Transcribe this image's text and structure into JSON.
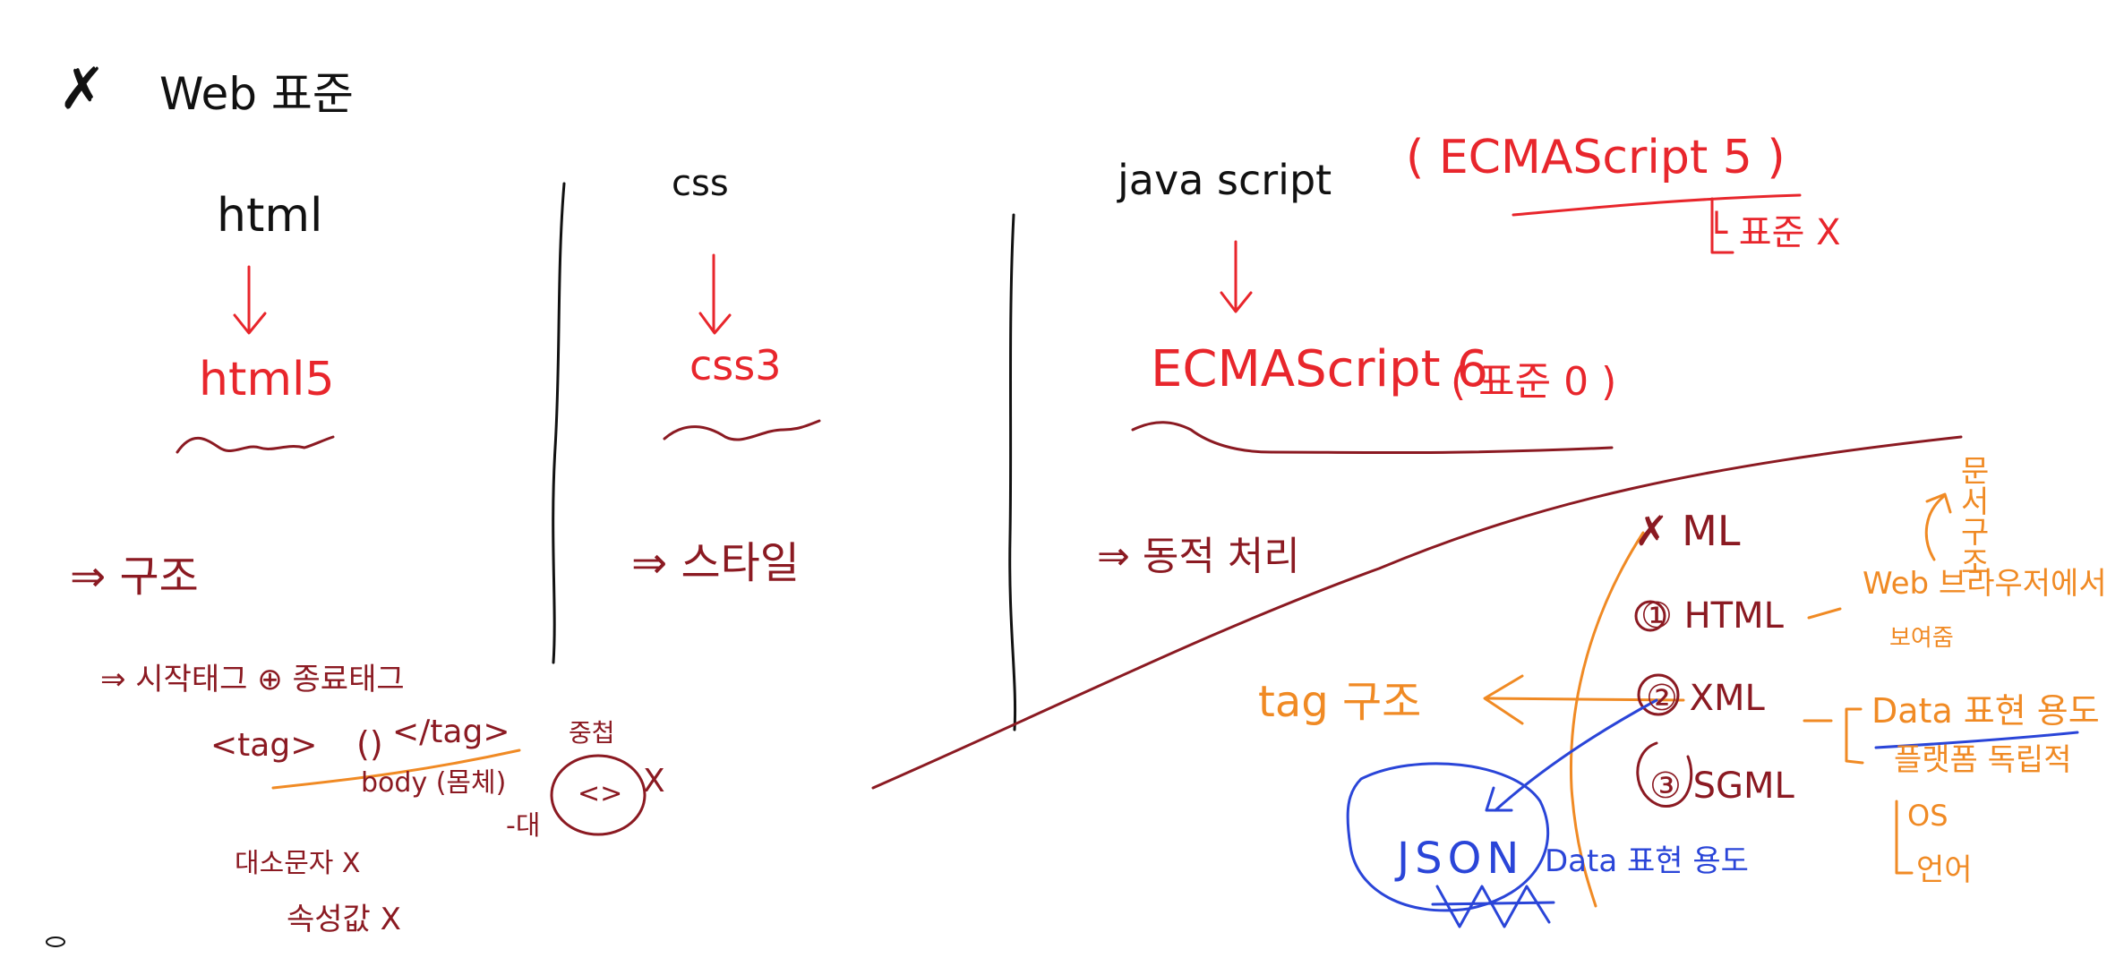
{
  "colors": {
    "black": "#111111",
    "maroon": "#8b1a22",
    "red": "#e8262c",
    "orange": "#f08a24",
    "blue": "#2a45d8"
  },
  "header": {
    "mark": "✗",
    "title": "Web 표준"
  },
  "html_column": {
    "title": "html",
    "version": "html5",
    "role": "⇒ 구조",
    "rule": "⇒ 시작태그 ⊕ 종료태그",
    "example_open": "<tag>",
    "example_content": "()",
    "example_close": "</tag>",
    "body_note": "body (몸체)",
    "nested_label": "중첩",
    "nested_circle_text": "<>",
    "nested_mark": "X",
    "note_case": "대소문자 X",
    "note_attr": "속성값 X",
    "side_mark": "-대"
  },
  "css_column": {
    "title": "css",
    "version": "css3",
    "role": "⇒ 스타일"
  },
  "js_column": {
    "title": "java script",
    "legacy": "( ECMAScript 5 )",
    "legacy_note": "└ 표준 X",
    "version": "ECMAScript 6",
    "version_note": "( 표준 0 )",
    "role": "⇒ 동적 처리"
  },
  "markup_section": {
    "heading": "✗ ML",
    "items": [
      "① HTML",
      "② XML",
      "③ SGML"
    ],
    "tag_label": "tag 구조",
    "doc_structure": "문서 구조",
    "html_note": "Web 브라우저에서",
    "html_subnote": "보여줌",
    "xml_note": "Data 표현 용도",
    "xml_subnote": "플랫폼 독립적",
    "platform_items": [
      "OS",
      "언어"
    ],
    "json": "JSON",
    "json_note": "Data 표현 용도"
  }
}
